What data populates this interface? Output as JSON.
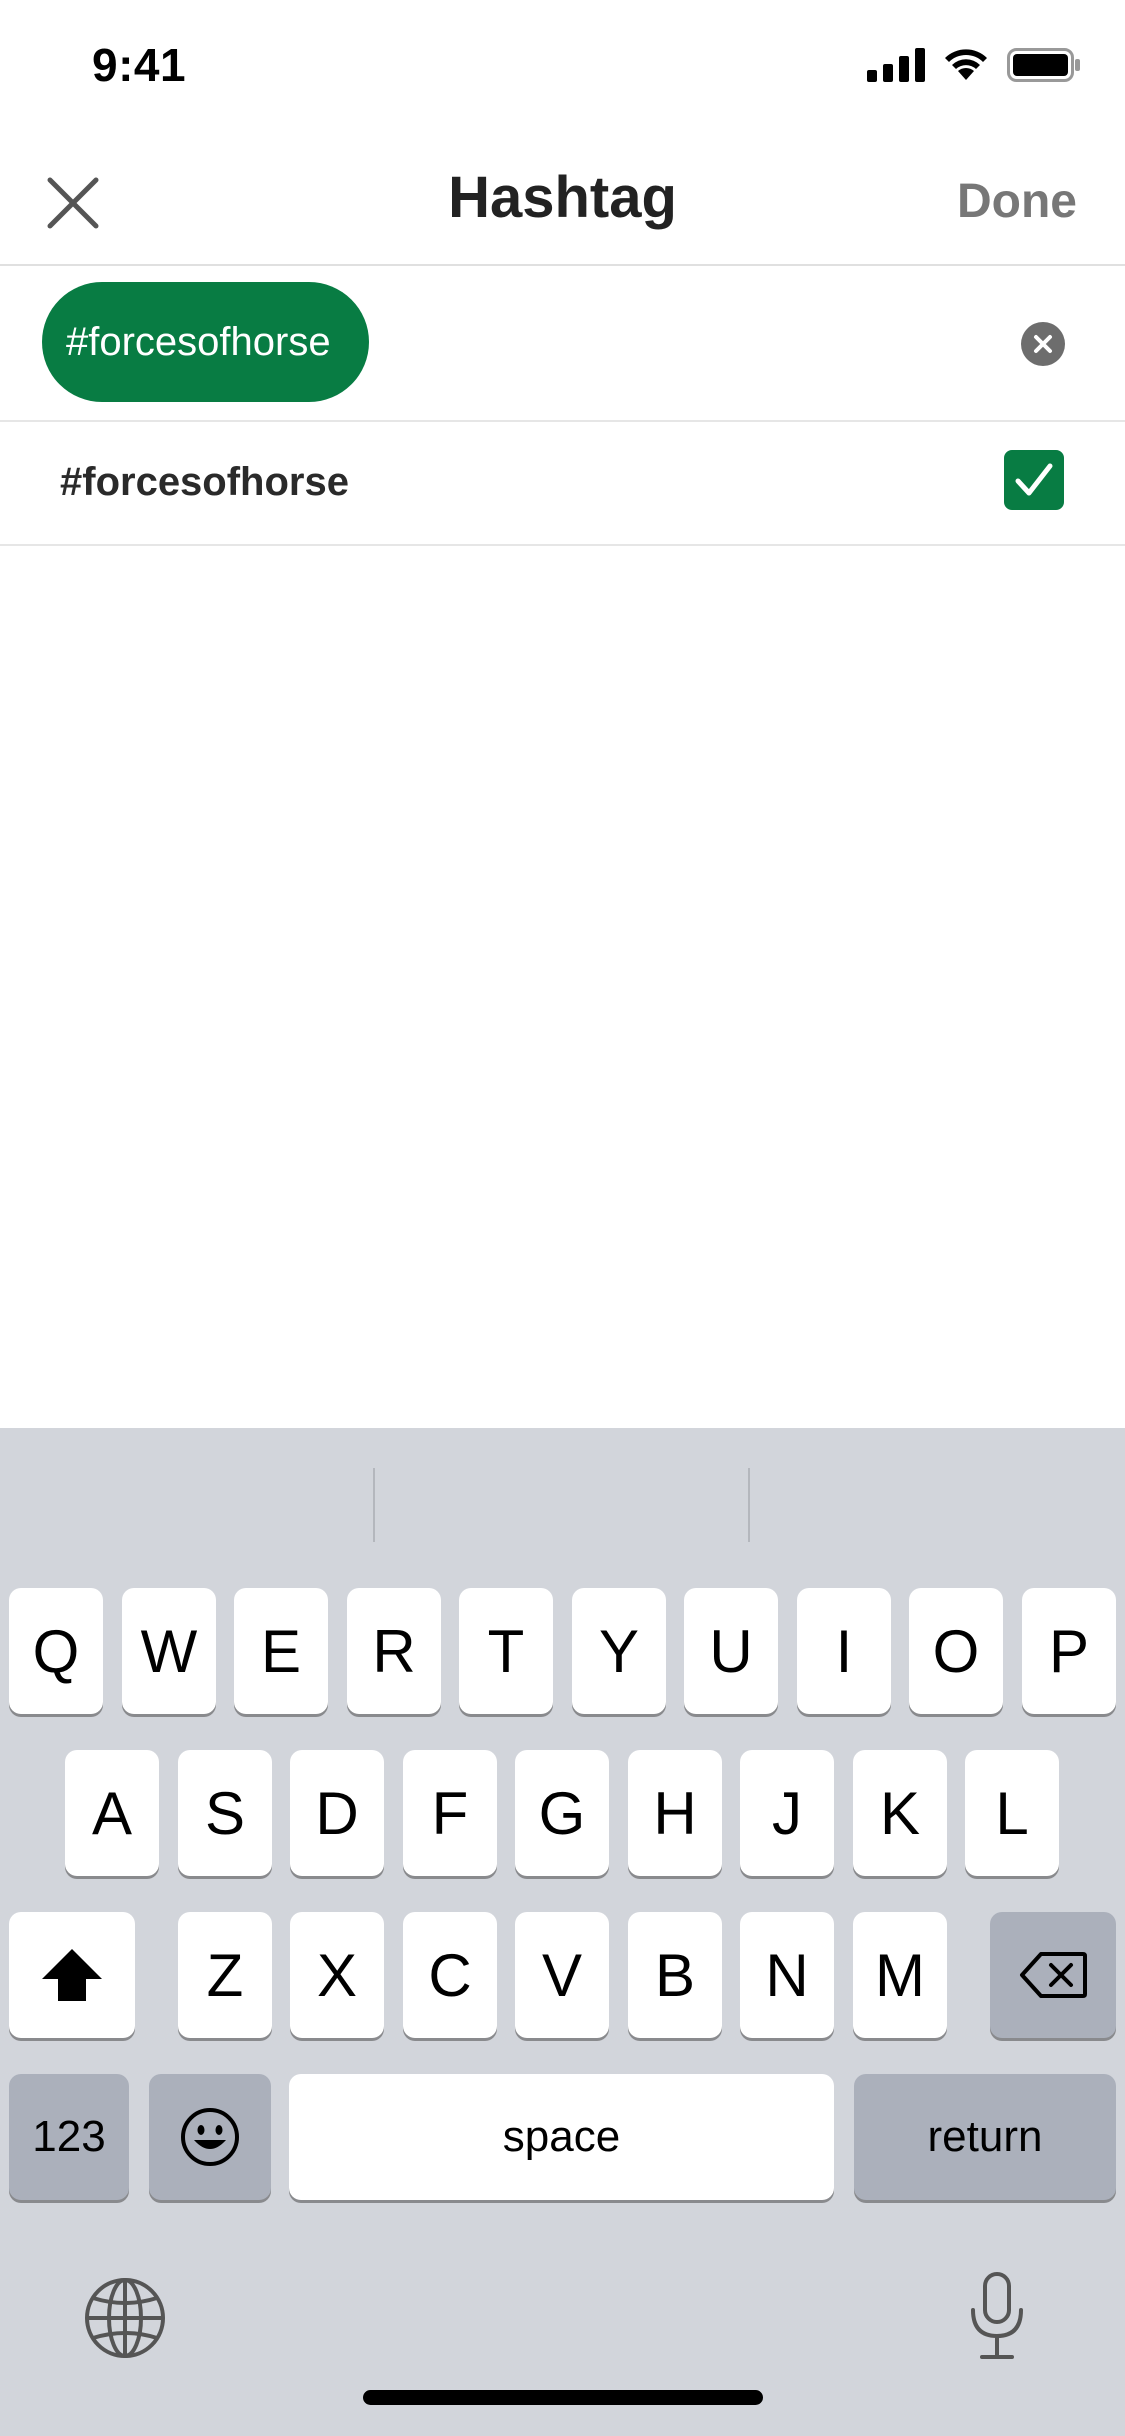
{
  "status_bar": {
    "time": "9:41"
  },
  "nav": {
    "title": "Hashtag",
    "done_label": "Done"
  },
  "input": {
    "chip_text": "#forcesofhorse"
  },
  "suggestion": {
    "text": "#forcesofhorse",
    "checked": true
  },
  "keyboard": {
    "row1": [
      "Q",
      "W",
      "E",
      "R",
      "T",
      "Y",
      "U",
      "I",
      "O",
      "P"
    ],
    "row2": [
      "A",
      "S",
      "D",
      "F",
      "G",
      "H",
      "J",
      "K",
      "L"
    ],
    "row3": [
      "Z",
      "X",
      "C",
      "V",
      "B",
      "N",
      "M"
    ],
    "numbers_label": "123",
    "space_label": "space",
    "return_label": "return"
  },
  "colors": {
    "accent": "#087c43",
    "keyboard_bg": "#d2d5db",
    "key_dark": "#abb0bb"
  },
  "icons": [
    "signal-icon",
    "wifi-icon",
    "battery-icon",
    "close-icon",
    "clear-icon",
    "checkmark-icon",
    "shift-icon",
    "backspace-icon",
    "emoji-icon",
    "globe-icon",
    "microphone-icon"
  ]
}
